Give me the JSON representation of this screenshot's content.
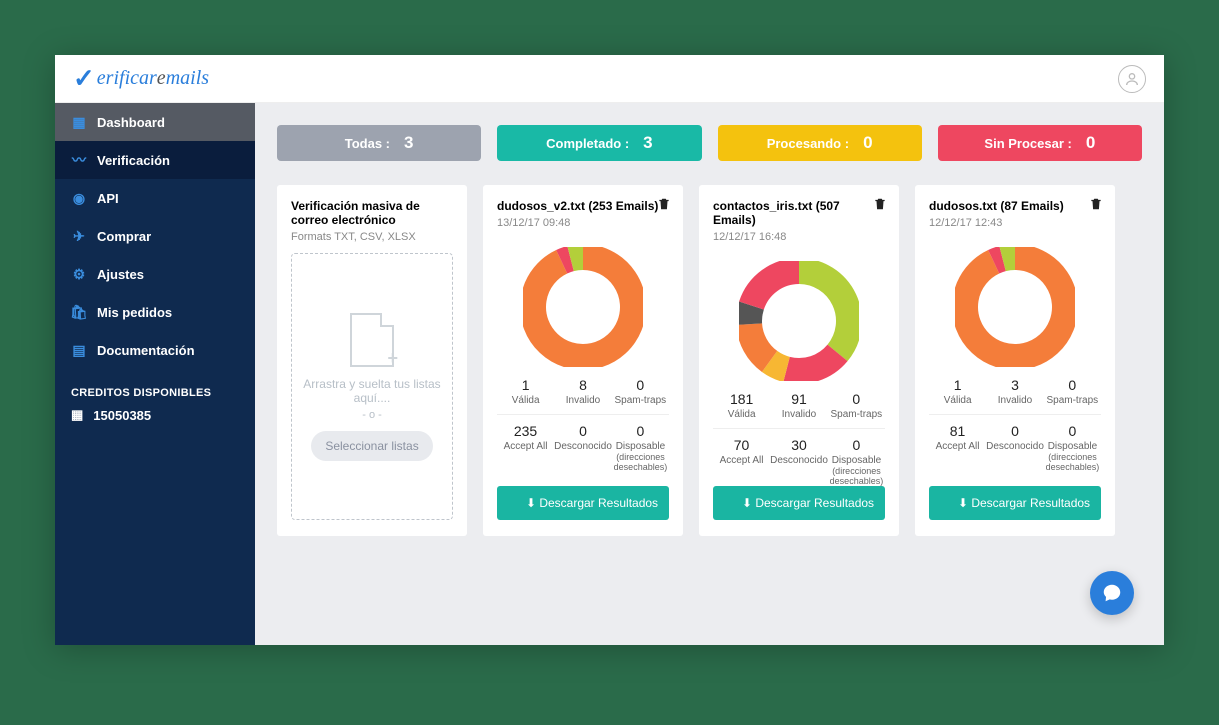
{
  "logo": {
    "check": "✓",
    "p1": "erificar",
    "p2": "e",
    "p3": "mails"
  },
  "sidebar": {
    "items": [
      {
        "icon": "▦",
        "label": "Dashboard"
      },
      {
        "icon": "〰",
        "label": "Verificación"
      },
      {
        "icon": "◉",
        "label": "API"
      },
      {
        "icon": "✈",
        "label": "Comprar"
      },
      {
        "icon": "⚙",
        "label": "Ajustes"
      },
      {
        "icon": "🛍",
        "label": "Mis pedidos"
      },
      {
        "icon": "▤",
        "label": "Documentación"
      }
    ],
    "credits_title": "CREDITOS DISPONIBLES",
    "credits_value": "15050385"
  },
  "status": {
    "todas": {
      "label": "Todas :",
      "value": "3"
    },
    "completado": {
      "label": "Completado :",
      "value": "3"
    },
    "procesando": {
      "label": "Procesando :",
      "value": "0"
    },
    "sin": {
      "label": "Sin Procesar :",
      "value": "0"
    }
  },
  "uploadCard": {
    "title": "Verificación masiva de correo electrónico",
    "formats": "Formats TXT, CSV, XLSX",
    "dropText": "Arrastra y suelta tus listas aquí....",
    "or": "- o -",
    "btn": "Seleccionar listas"
  },
  "labels": {
    "valida": "Válida",
    "invalido": "Invalido",
    "spamtraps": "Spam-traps",
    "acceptall": "Accept All",
    "desconocido": "Desconocido",
    "disposable": "Disposable",
    "disposable_sub": "(direcciones desechables)",
    "download": "Descargar Resultados"
  },
  "results": [
    {
      "title": "dudosos_v2.txt (253 Emails)",
      "date": "13/12/17 09:48",
      "valida": "1",
      "invalido": "8",
      "spamtraps": "0",
      "acceptall": "235",
      "desconocido": "0",
      "disposable": "0",
      "segs": [
        {
          "c": "#f47d3a",
          "p": 93
        },
        {
          "c": "#ee4760",
          "p": 3
        },
        {
          "c": "#b3cf3a",
          "p": 4
        }
      ]
    },
    {
      "title": "contactos_iris.txt (507 Emails)",
      "date": "12/12/17 16:48",
      "valida": "181",
      "invalido": "91",
      "spamtraps": "0",
      "acceptall": "70",
      "desconocido": "30",
      "disposable": "0",
      "segs": [
        {
          "c": "#b3cf3a",
          "p": 36
        },
        {
          "c": "#ee4760",
          "p": 18
        },
        {
          "c": "#f7b733",
          "p": 6
        },
        {
          "c": "#f47d3a",
          "p": 14
        },
        {
          "c": "#555",
          "p": 6
        },
        {
          "c": "#ee4760",
          "p": 20
        }
      ]
    },
    {
      "title": "dudosos.txt (87 Emails)",
      "date": "12/12/17 12:43",
      "valida": "1",
      "invalido": "3",
      "spamtraps": "0",
      "acceptall": "81",
      "desconocido": "0",
      "disposable": "0",
      "segs": [
        {
          "c": "#f47d3a",
          "p": 93
        },
        {
          "c": "#ee4760",
          "p": 3
        },
        {
          "c": "#b3cf3a",
          "p": 4
        }
      ]
    }
  ]
}
